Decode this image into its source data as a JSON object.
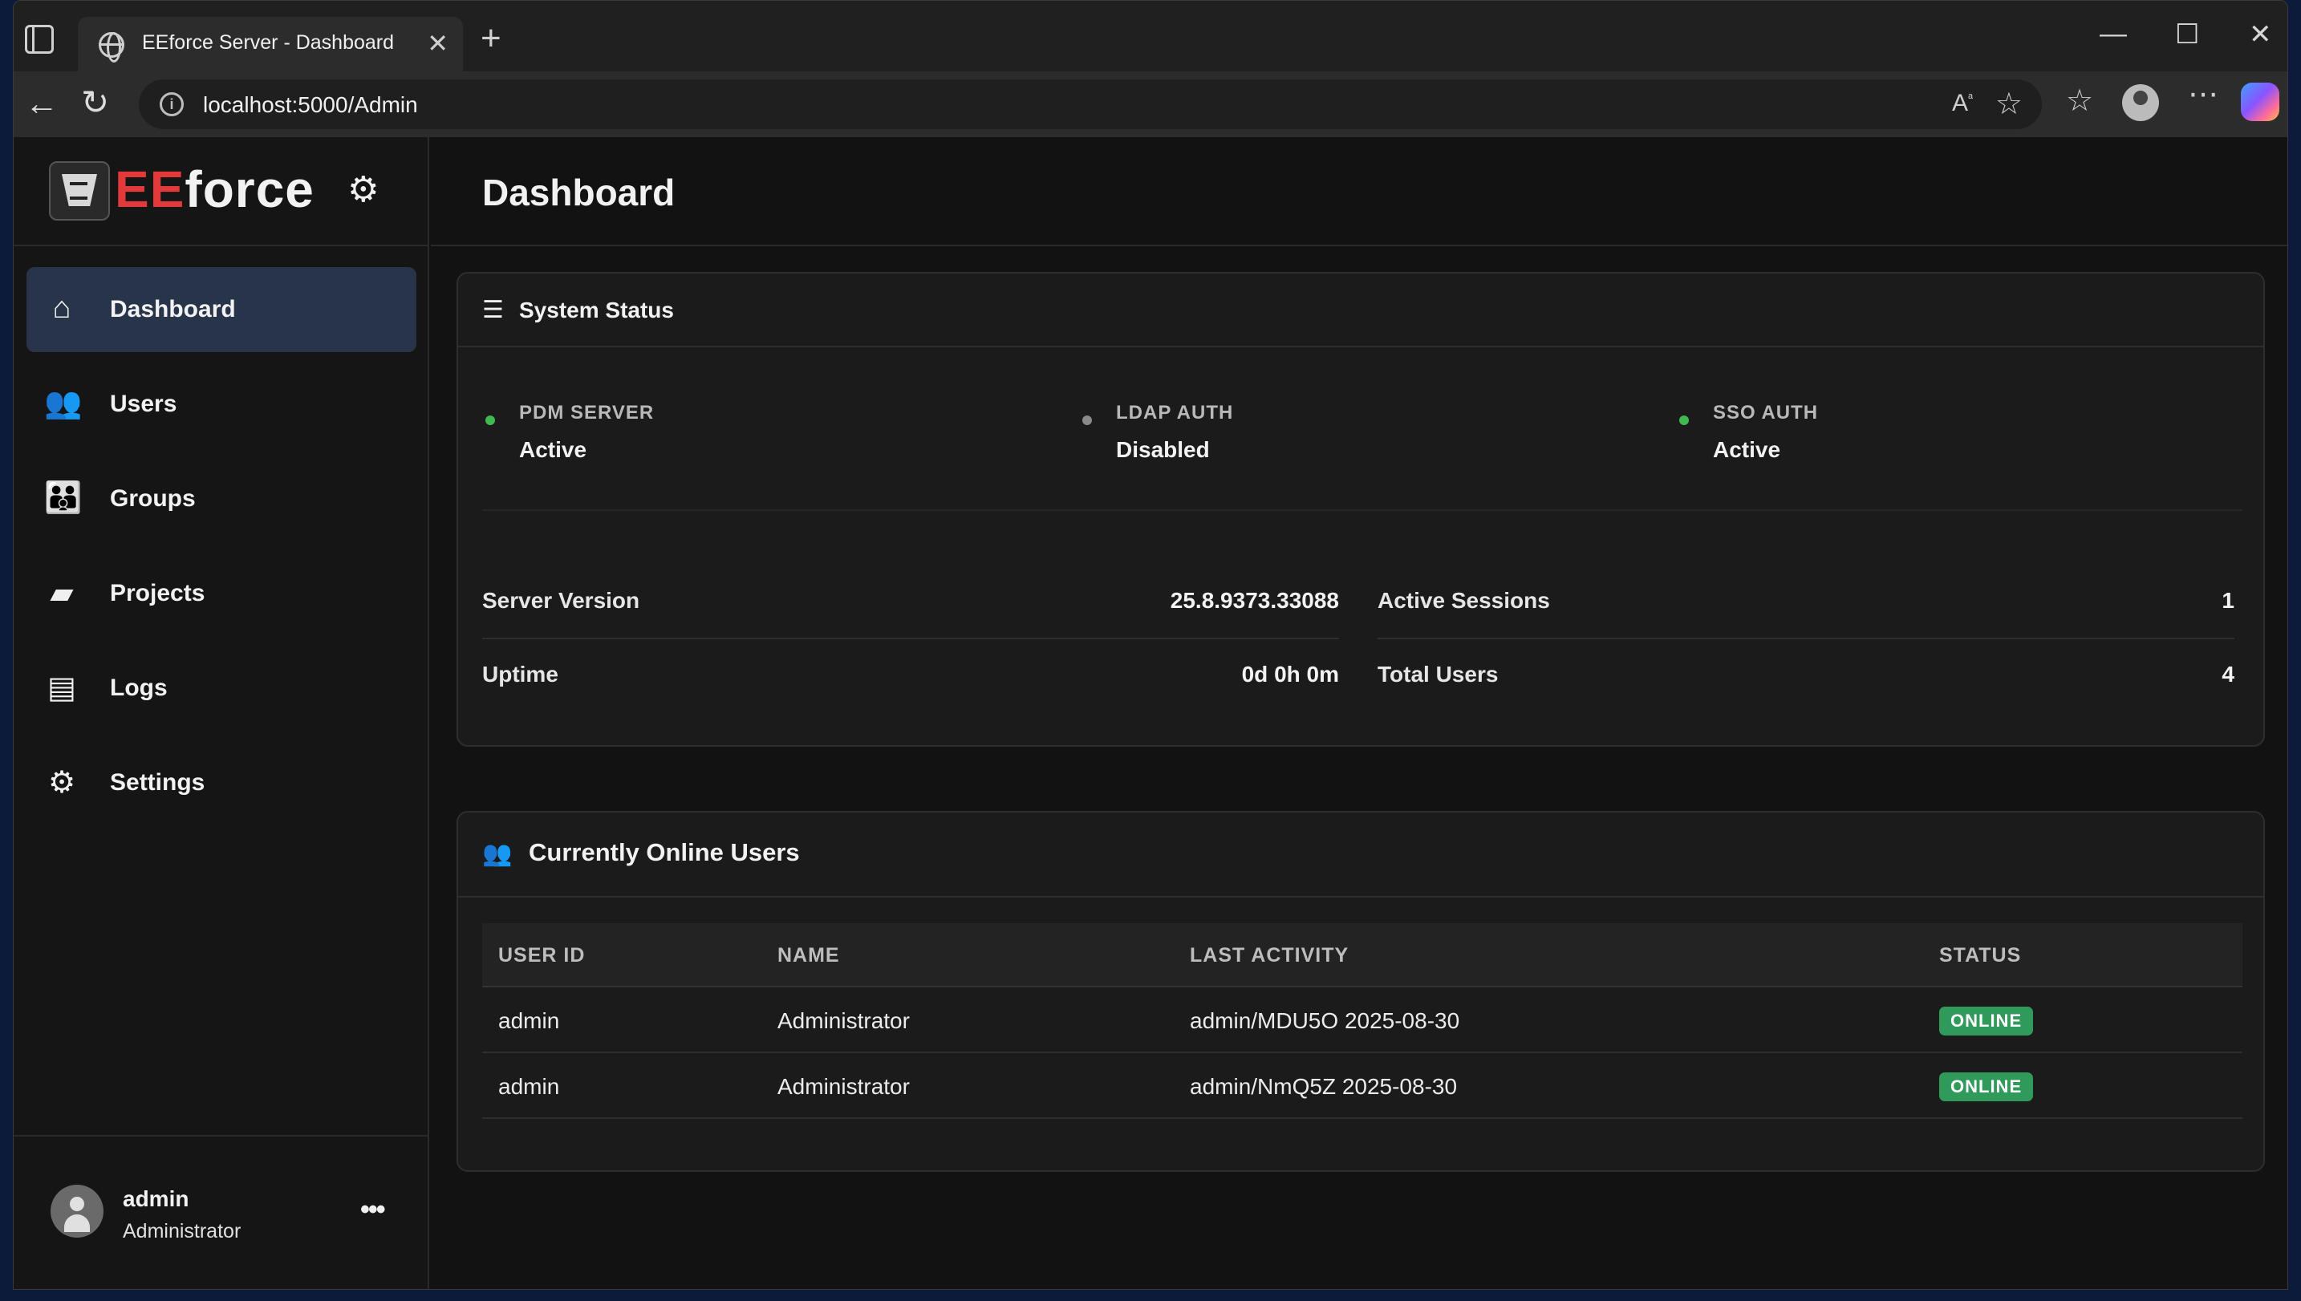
{
  "browser": {
    "tab_title": "EEforce Server - Dashboard",
    "url": "localhost:5000/Admin",
    "tab_close": "✕",
    "new_tab": "+",
    "minimize": "—",
    "maximize": "☐",
    "close": "✕"
  },
  "brand": {
    "prefix": "EE",
    "suffix": "force"
  },
  "sidebar": {
    "items": [
      {
        "label": "Dashboard",
        "icon": "home-icon",
        "active": true
      },
      {
        "label": "Users",
        "icon": "users-icon"
      },
      {
        "label": "Groups",
        "icon": "groups-icon"
      },
      {
        "label": "Projects",
        "icon": "folder-icon"
      },
      {
        "label": "Logs",
        "icon": "file-icon"
      },
      {
        "label": "Settings",
        "icon": "gear-icon"
      }
    ],
    "user": {
      "name": "admin",
      "role": "Administrator",
      "more": "•••"
    }
  },
  "header": {
    "title": "Dashboard"
  },
  "system_status": {
    "title": "System Status",
    "services": [
      {
        "label": "PDM SERVER",
        "value": "Active",
        "color": "#3fb950"
      },
      {
        "label": "LDAP AUTH",
        "value": "Disabled",
        "color": "#8a8a8a"
      },
      {
        "label": "SSO AUTH",
        "value": "Active",
        "color": "#3fb950"
      }
    ],
    "info": [
      {
        "label": "Server Version",
        "value": "25.8.9373.33088"
      },
      {
        "label": "Active Sessions",
        "value": "1"
      },
      {
        "label": "Uptime",
        "value": "0d 0h 0m"
      },
      {
        "label": "Total Users",
        "value": "4"
      }
    ]
  },
  "online_users": {
    "title": "Currently Online Users",
    "columns": [
      "USER ID",
      "NAME",
      "LAST ACTIVITY",
      "STATUS"
    ],
    "rows": [
      {
        "user_id": "admin",
        "name": "Administrator",
        "last_activity": "admin/MDU5O 2025-08-30",
        "status": "ONLINE"
      },
      {
        "user_id": "admin",
        "name": "Administrator",
        "last_activity": "admin/NmQ5Z 2025-08-30",
        "status": "ONLINE"
      }
    ]
  },
  "colors": {
    "accent": "#e23a3a",
    "online_badge": "#2f9a5a",
    "active_nav": "#27344a"
  }
}
